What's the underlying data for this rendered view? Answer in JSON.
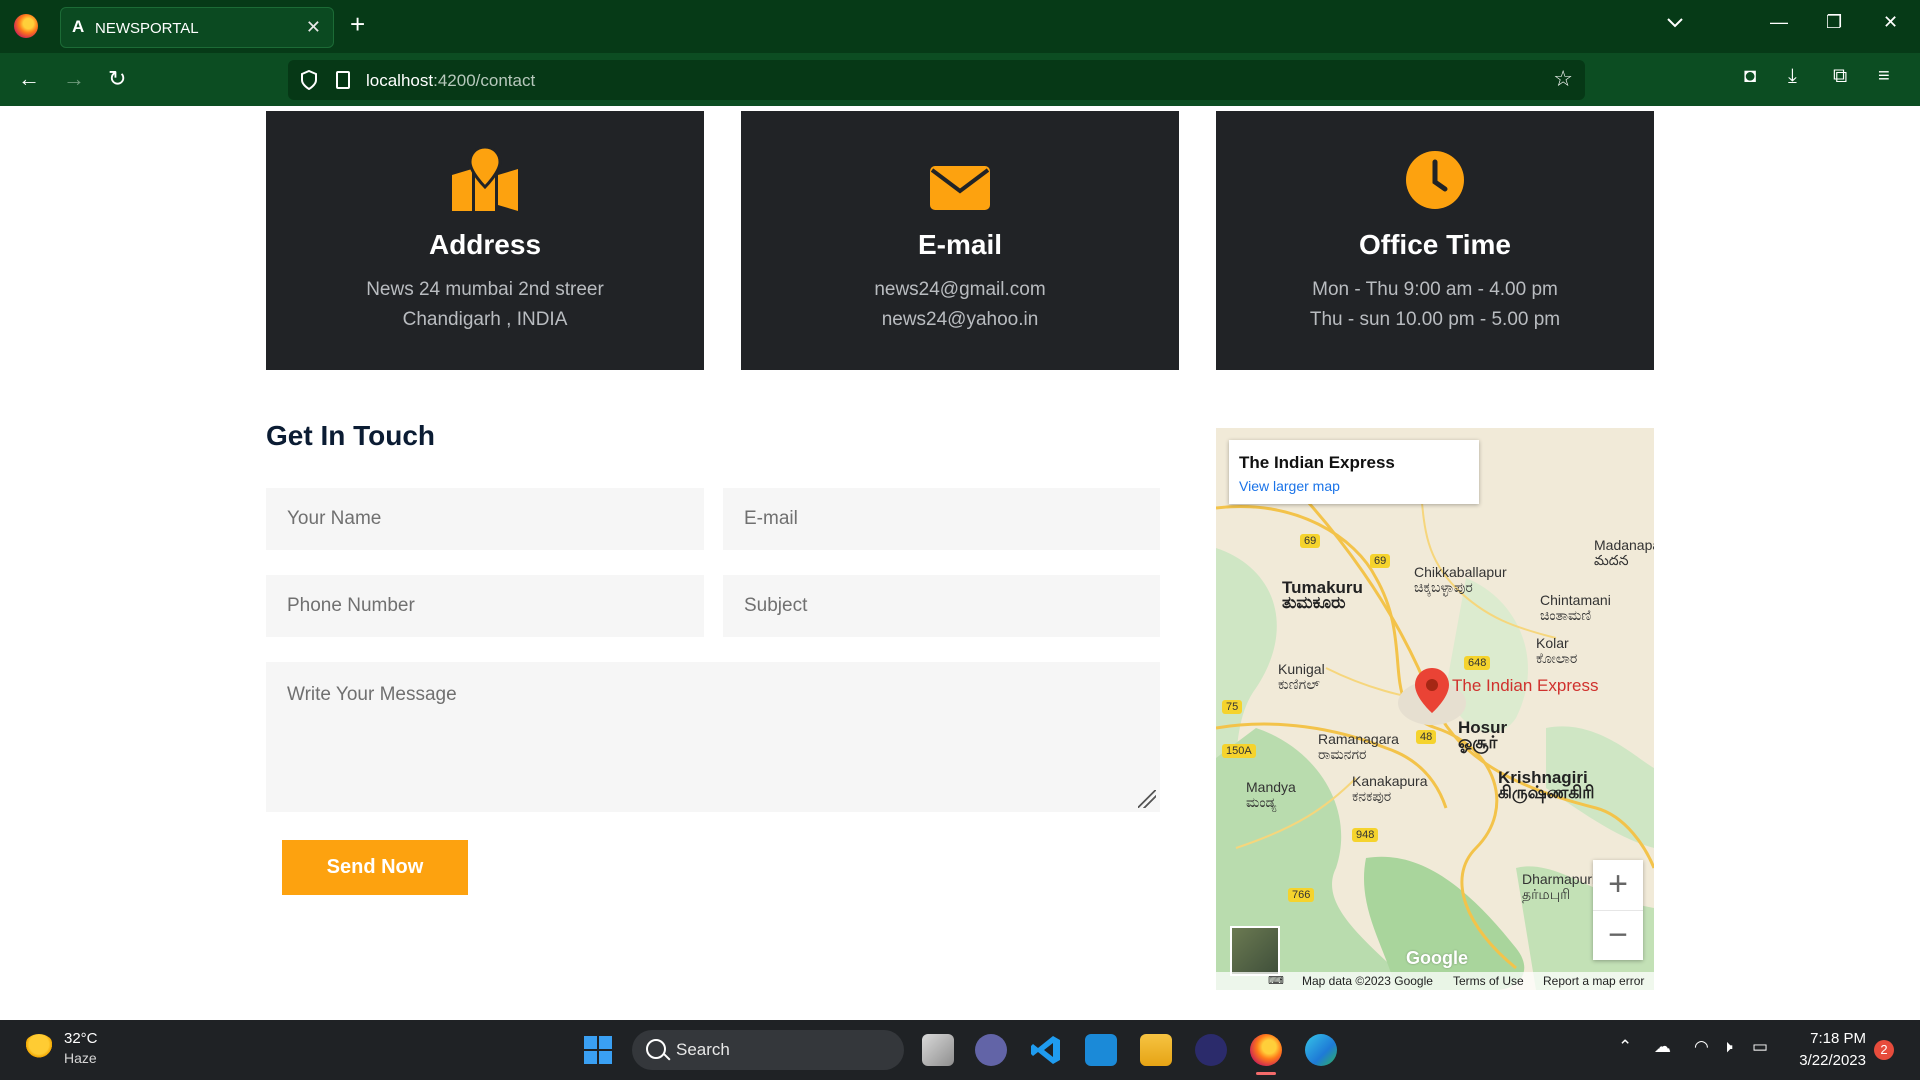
{
  "browser": {
    "tab_title": "NEWSPORTAL",
    "tab_favicon": "A",
    "url_host": "localhost",
    "url_path": ":4200/contact"
  },
  "cards": [
    {
      "icon": "map-icon",
      "title": "Address",
      "lines": [
        "News 24 mumbai 2nd streer",
        "Chandigarh , INDIA"
      ]
    },
    {
      "icon": "envelope-icon",
      "title": "E-mail",
      "lines": [
        "news24@gmail.com",
        "news24@yahoo.in"
      ]
    },
    {
      "icon": "clock-icon",
      "title": "Office Time",
      "lines": [
        "Mon - Thu 9:00 am - 4.00 pm",
        "Thu - sun 10.00 pm - 5.00 pm"
      ]
    }
  ],
  "contact_form": {
    "title": "Get In Touch",
    "name_placeholder": "Your Name",
    "email_placeholder": "E-mail",
    "phone_placeholder": "Phone Number",
    "subject_placeholder": "Subject",
    "message_placeholder": "Write Your Message",
    "submit_label": "Send Now"
  },
  "map": {
    "info_title": "The Indian Express",
    "info_link": "View larger map",
    "marker_label": "The Indian Express",
    "places": [
      {
        "name": "Tumakuru",
        "native": "ತುಮಕೂರು"
      },
      {
        "name": "Chikkaballapur",
        "native": "ಚಿಕ್ಕಬಳ್ಳಾಪುರ"
      },
      {
        "name": "Chintamani",
        "native": "ಚಿಂತಾಮಣಿ"
      },
      {
        "name": "Kolar",
        "native": "ಕೋಲಾರ"
      },
      {
        "name": "Kunigal",
        "native": "ಕುಣಿಗಲ್"
      },
      {
        "name": "Hosur",
        "native": "ஓசூர்"
      },
      {
        "name": "Ramanagara",
        "native": "ರಾಮನಗರ"
      },
      {
        "name": "Kanakapura",
        "native": "ಕನಕಪುರ"
      },
      {
        "name": "Mandya",
        "native": "ಮಂಡ್ಯ"
      },
      {
        "name": "Krishnagiri",
        "native": "கிருஷ்ணகிரி"
      },
      {
        "name": "Dharmapuri",
        "native": "தர்மபுரி"
      },
      {
        "name": "Madanapalle",
        "native": "మదన"
      }
    ],
    "roads": [
      "69",
      "69",
      "648",
      "75",
      "48",
      "150A",
      "948",
      "766"
    ],
    "footer_data": "Map data ©2023 Google",
    "footer_terms": "Terms of Use",
    "footer_report": "Report a map error",
    "logo": "Google",
    "zoom_in": "+",
    "zoom_out": "−"
  },
  "taskbar": {
    "temperature": "32°C",
    "weather": "Haze",
    "search_label": "Search",
    "time": "7:18 PM",
    "date": "3/22/2023",
    "notification_count": "2"
  },
  "colors": {
    "accent": "#fda20f",
    "card_bg": "#212326",
    "browser_green": "#0c4d22"
  }
}
